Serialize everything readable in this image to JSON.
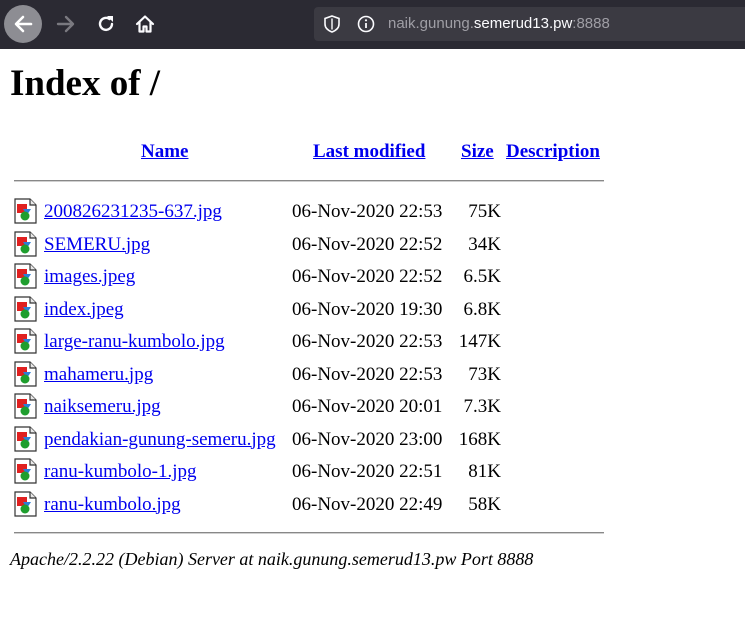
{
  "browser": {
    "url_prefix": "naik.gunung.",
    "url_host": "semerud13.pw",
    "url_port": ":8888",
    "icons": [
      "back-arrow-icon",
      "forward-arrow-icon",
      "reload-icon",
      "home-icon",
      "shield-icon",
      "info-icon"
    ]
  },
  "page": {
    "title": "Index of /",
    "columns": {
      "name": "Name",
      "last_modified": "Last modified",
      "size": "Size",
      "description": "Description"
    },
    "files": [
      {
        "name": "200826231235-637.jpg",
        "modified": "06-Nov-2020 22:53",
        "size": "75K"
      },
      {
        "name": "SEMERU.jpg",
        "modified": "06-Nov-2020 22:52",
        "size": "34K"
      },
      {
        "name": "images.jpeg",
        "modified": "06-Nov-2020 22:52",
        "size": "6.5K"
      },
      {
        "name": "index.jpeg",
        "modified": "06-Nov-2020 19:30",
        "size": "6.8K"
      },
      {
        "name": "large-ranu-kumbolo.jpg",
        "modified": "06-Nov-2020 22:53",
        "size": "147K"
      },
      {
        "name": "mahameru.jpg",
        "modified": "06-Nov-2020 22:53",
        "size": "73K"
      },
      {
        "name": "naiksemeru.jpg",
        "modified": "06-Nov-2020 20:01",
        "size": "7.3K"
      },
      {
        "name": "pendakian-gunung-semeru.jpg",
        "modified": "06-Nov-2020 23:00",
        "size": "168K"
      },
      {
        "name": "ranu-kumbolo-1.jpg",
        "modified": "06-Nov-2020 22:51",
        "size": "81K"
      },
      {
        "name": "ranu-kumbolo.jpg",
        "modified": "06-Nov-2020 22:49",
        "size": "58K"
      }
    ],
    "footer": "Apache/2.2.22 (Debian) Server at naik.gunung.semerud13.pw Port 8888"
  }
}
